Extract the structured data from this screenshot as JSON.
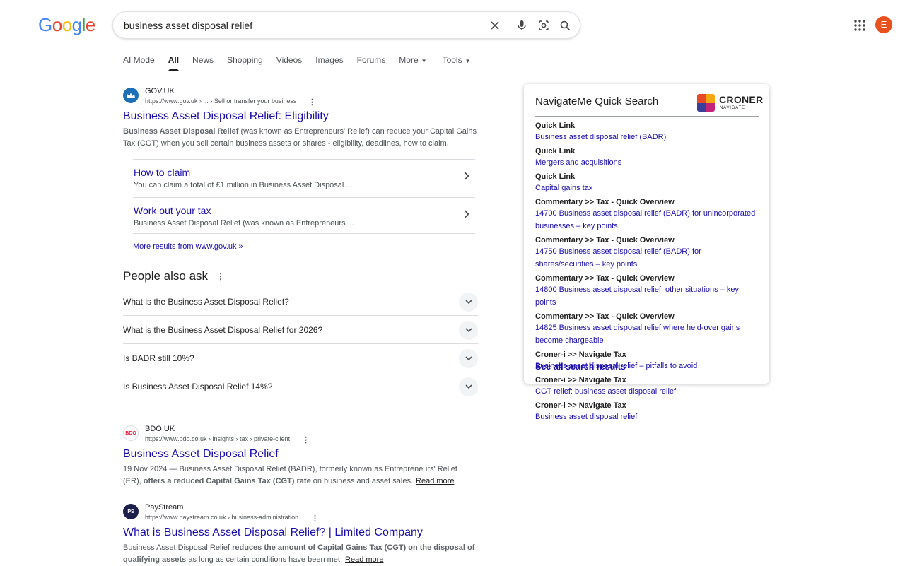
{
  "header": {
    "logo": [
      "G",
      "o",
      "o",
      "g",
      "l",
      "e"
    ],
    "logo_colors": [
      "#4285F4",
      "#EA4335",
      "#FBBC05",
      "#4285F4",
      "#34A853",
      "#EA4335"
    ],
    "query": "business asset disposal relief",
    "avatar_letter": "E",
    "icons": [
      "clear-icon",
      "mic-icon",
      "lens-icon",
      "search-icon",
      "apps-icon"
    ]
  },
  "tabs": [
    "AI Mode",
    "All",
    "News",
    "Shopping",
    "Videos",
    "Images",
    "Forums",
    "More",
    "Tools"
  ],
  "results": [
    {
      "site": "GOV.UK",
      "url": "https://www.gov.uk › ... › Sell or transfer your business",
      "title": "Business Asset Disposal Relief: Eligibility",
      "snippet_bold": "Business Asset Disposal Relief",
      "snippet_rest": " (was known as Entrepreneurs' Relief) can reduce your Capital Gains Tax (CGT) when you sell certain business assets or shares - eligibility, deadlines, how to claim.",
      "sitelinks": [
        {
          "title": "How to claim",
          "desc": "You can claim a total of £1 million in Business Asset Disposal ..."
        },
        {
          "title": "Work out your tax",
          "desc": "Business Asset Disposal Relief (was known as Entrepreneurs ..."
        }
      ],
      "more": "More results from www.gov.uk »"
    },
    {
      "site": "BDO UK",
      "favicon_text": "BDO",
      "url": "https://www.bdo.co.uk › insights › tax › private-client",
      "title": "Business Asset Disposal Relief",
      "snippet_date": "19 Nov 2024",
      "snippet_a": " — Business Asset Disposal Relief (BADR), formerly known as Entrepreneurs' Relief (ER), ",
      "snippet_bold": "offers a reduced Capital Gains Tax (CGT) rate",
      "snippet_b": " on business and asset sales.",
      "read_more": "Read more"
    },
    {
      "site": "PayStream",
      "favicon_text": "PS",
      "url": "https://www.paystream.co.uk › business-administration",
      "title": "What is Business Asset Disposal Relief? | Limited Company",
      "snippet_a": "Business Asset Disposal Relief ",
      "snippet_bold": "reduces the amount of Capital Gains Tax (CGT) on the disposal of qualifying assets",
      "snippet_b": " as long as certain conditions have been met.",
      "read_more": "Read more"
    }
  ],
  "people_also_ask": {
    "title": "People also ask",
    "questions": [
      "What is the Business Asset Disposal Relief?",
      "What is the Business Asset Disposal Relief for 2026?",
      "Is BADR still 10%?",
      "Is Business Asset Disposal Relief 14%?"
    ]
  },
  "panel": {
    "title": "NavigateMe Quick Search",
    "brand": "CRONER",
    "brand_sub": "NAVIGATE",
    "items": [
      {
        "cat": "Quick Link",
        "link": "Business asset disposal relief (BADR)"
      },
      {
        "cat": "Quick Link",
        "link": "Mergers and acquisitions"
      },
      {
        "cat": "Quick Link",
        "link": "Capital gains tax"
      },
      {
        "cat": "Commentary >> Tax - Quick Overview",
        "link": "14700 Business asset disposal relief (BADR) for unincorporated businesses – key points"
      },
      {
        "cat": "Commentary >> Tax - Quick Overview",
        "link": "14750 Business asset disposal relief (BADR) for shares/securities – key points"
      },
      {
        "cat": "Commentary >> Tax - Quick Overview",
        "link": "14800 Business asset disposal relief: other situations – key points"
      },
      {
        "cat": "Commentary >> Tax - Quick Overview",
        "link": "14825 Business asset disposal relief where held-over gains become chargeable"
      },
      {
        "cat": "Croner-i >> Navigate Tax",
        "link": "Business asset disposal relief – pitfalls to avoid"
      },
      {
        "cat": "Croner-i >> Navigate Tax",
        "link": "CGT relief: business asset disposal relief"
      },
      {
        "cat": "Croner-i >> Navigate Tax",
        "link": "Business asset disposal relief"
      }
    ],
    "see_all": "See all search results"
  }
}
